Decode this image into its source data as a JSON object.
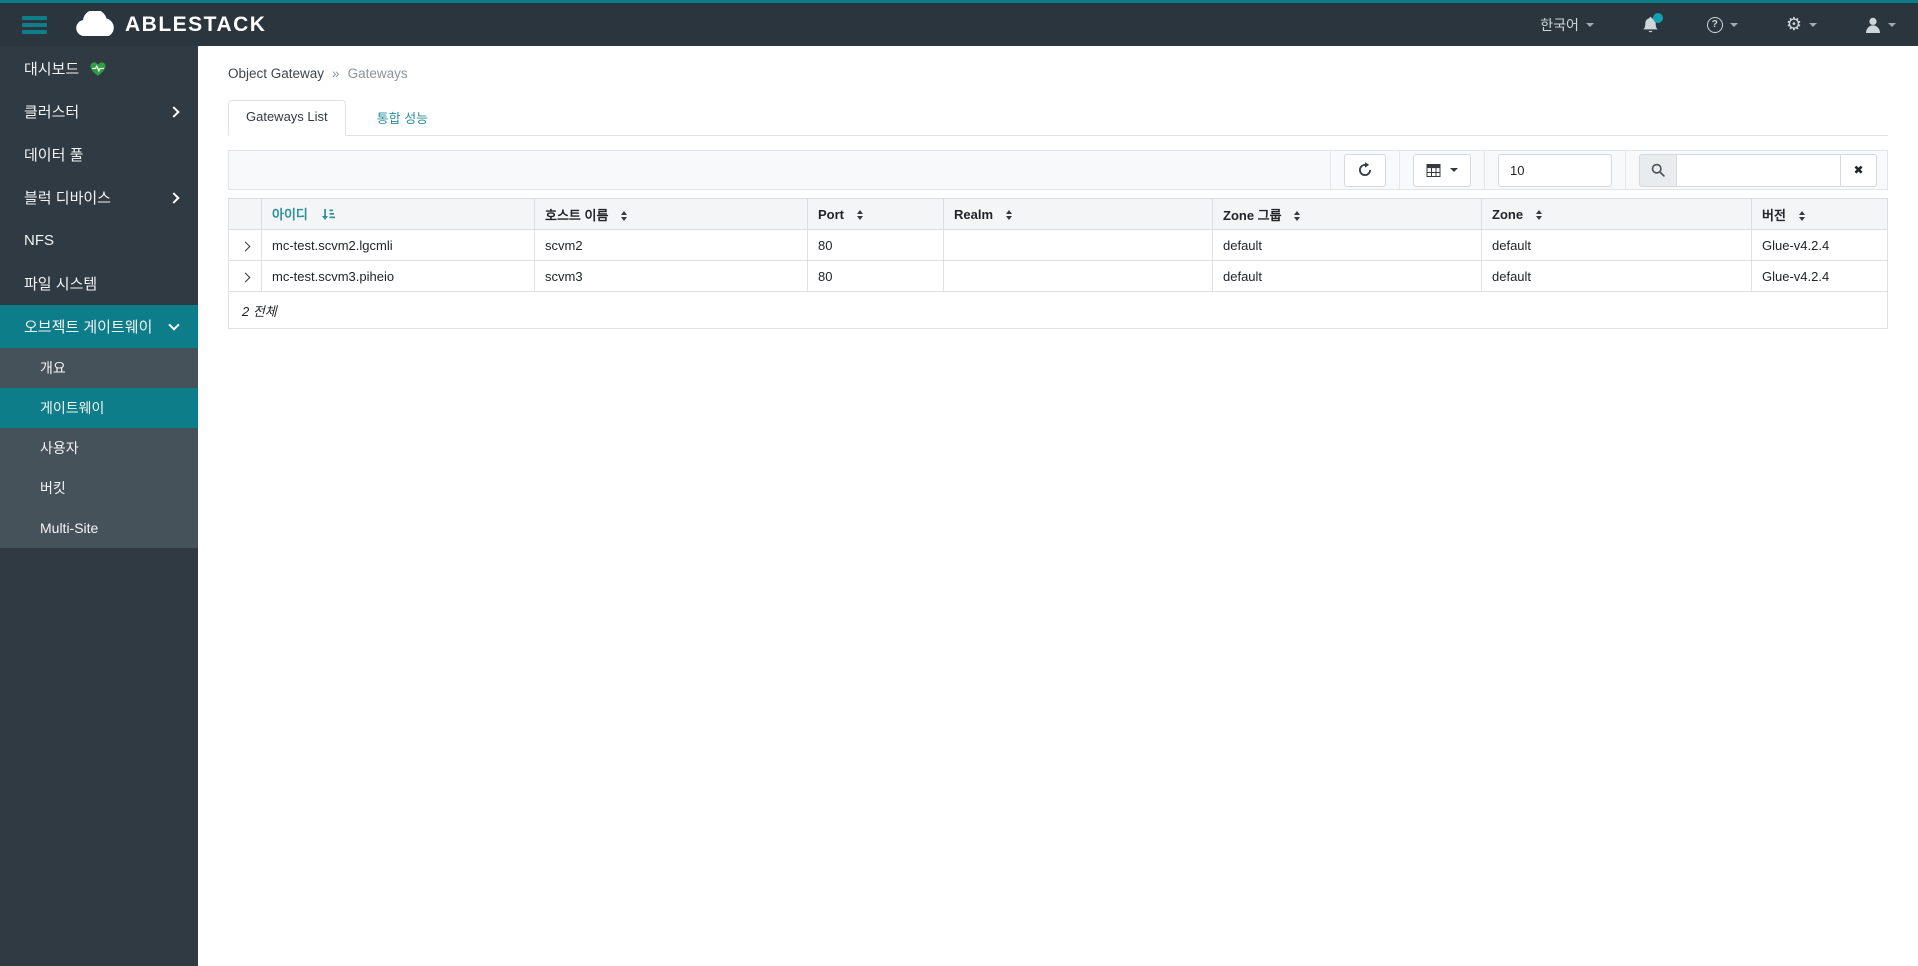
{
  "navbar": {
    "brand": "ABLESTACK",
    "language": "한국어"
  },
  "sidebar": {
    "items": [
      {
        "label": "대시보드"
      },
      {
        "label": "클러스터"
      },
      {
        "label": "데이터 풀"
      },
      {
        "label": "블럭 디바이스"
      },
      {
        "label": "NFS"
      },
      {
        "label": "파일 시스템"
      },
      {
        "label": "오브젝트 게이트웨이"
      }
    ],
    "subitems": [
      {
        "label": "개요"
      },
      {
        "label": "게이트웨이"
      },
      {
        "label": "사용자"
      },
      {
        "label": "버킷"
      },
      {
        "label": "Multi-Site"
      }
    ]
  },
  "page": {
    "breadcrumb": {
      "section": "Object Gateway",
      "separator": "»",
      "current": "Gateways"
    },
    "tabs": [
      {
        "label": "Gateways List"
      },
      {
        "label": "통합 성능"
      }
    ]
  },
  "toolbar": {
    "page_size": "10",
    "search_value": "",
    "search_placeholder": ""
  },
  "table": {
    "headers": {
      "id": "아이디",
      "host": "호스트 이름",
      "port": "Port",
      "realm": "Realm",
      "zonegroup": "Zone 그룹",
      "zone": "Zone",
      "version": "버전"
    },
    "rows": [
      {
        "id": "mc-test.scvm2.lgcmli",
        "host": "scvm2",
        "port": "80",
        "realm": "",
        "zonegroup": "default",
        "zone": "default",
        "version": "Glue-v4.2.4"
      },
      {
        "id": "mc-test.scvm3.piheio",
        "host": "scvm3",
        "port": "80",
        "realm": "",
        "zonegroup": "default",
        "zone": "default",
        "version": "Glue-v4.2.4"
      }
    ],
    "summary": "2 전체"
  },
  "icons": {
    "clear_glyph": "✖",
    "help_glyph": "?",
    "gear_glyph": "⚙"
  },
  "colors": {
    "accent": "#0c7d89",
    "link_teal": "#2b919c",
    "navbar_bg": "#2b353d",
    "sidebar_bg": "#2f3a42",
    "submenu_bg": "#46525a",
    "notification_dot": "#10a0b2",
    "heartbeat_green": "#2f9e44"
  }
}
